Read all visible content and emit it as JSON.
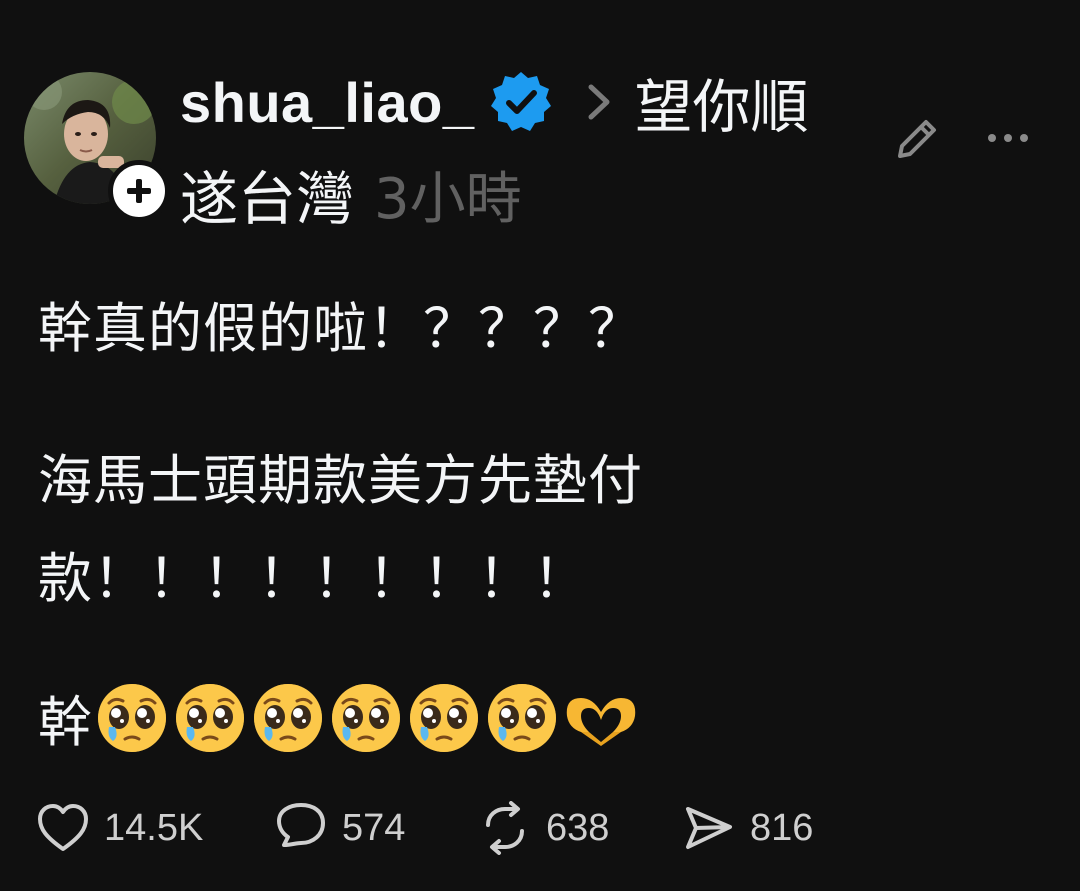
{
  "post": {
    "author": {
      "username": "shua_liao_",
      "verified": true,
      "avatar_icon": "avatar-photo",
      "follow_icon": "plus-icon"
    },
    "topic": {
      "part1": "望你順",
      "part2": "遂台灣"
    },
    "timestamp": "3小時",
    "text": {
      "line1": "幹真的假的啦！？？？？",
      "line2": "海馬士頭期款美方先墊付",
      "line3": "款！！！！！！！！！",
      "line4_prefix": "幹"
    },
    "emoji_sequence": [
      "pleading-face",
      "pleading-face",
      "pleading-face",
      "pleading-face",
      "pleading-face",
      "pleading-face",
      "heart-hands"
    ],
    "stats": {
      "likes": "14.5K",
      "comments": "574",
      "reposts": "638",
      "shares": "816"
    }
  },
  "colors": {
    "background": "#101010",
    "text": "#f3f5f7",
    "muted": "#616161",
    "verified_blue": "#1d9bf0"
  }
}
